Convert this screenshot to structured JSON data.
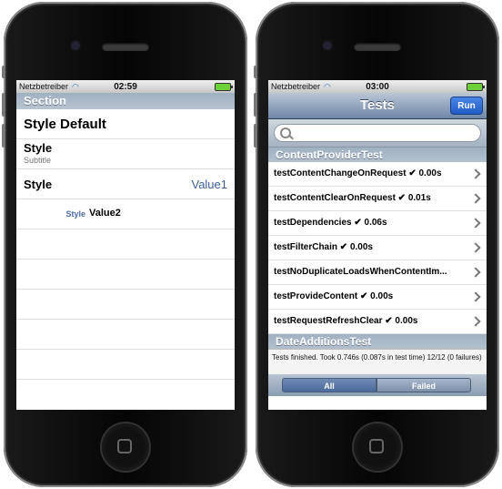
{
  "left_phone": {
    "status": {
      "carrier": "Netzbetreiber",
      "time": "02:59"
    },
    "section_header": "Section",
    "cells": {
      "default_title": "Style Default",
      "subtitle_title": "Style",
      "subtitle_text": "Subtitle",
      "value1_title": "Style",
      "value1_detail": "Value1",
      "value2_label": "Style",
      "value2_value": "Value2"
    }
  },
  "right_phone": {
    "status": {
      "carrier": "Netzbetreiber",
      "time": "03:00"
    },
    "nav": {
      "title": "Tests",
      "run_label": "Run"
    },
    "search": {
      "placeholder": ""
    },
    "sections": [
      {
        "title": "ContentProviderTest",
        "tests": [
          "testContentChangeOnRequest ✔ 0.00s",
          "testContentClearOnRequest ✔ 0.01s",
          "testDependencies ✔ 0.06s",
          "testFilterChain ✔ 0.00s",
          "testNoDuplicateLoadsWhenContentIm...",
          "testProvideContent ✔ 0.00s",
          "testRequestRefreshClear ✔ 0.00s"
        ]
      },
      {
        "title": "DateAdditionsTest"
      }
    ],
    "summary": "Tests finished. Took 0.746s (0.087s in test time) 12/12 (0 failures)",
    "segments": {
      "all_label": "All",
      "failed_label": "Failed"
    }
  },
  "colors": {
    "section_header": "#a9b8c8",
    "run_button": "#2f6fd8",
    "value_blue": "#3b5f95"
  }
}
